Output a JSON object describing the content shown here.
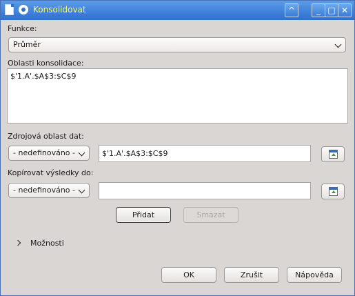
{
  "titlebar": {
    "title": "Konsolidovat",
    "minimize_label": "_",
    "maximize_label": "□",
    "close_label": "✕",
    "shade_label": "^"
  },
  "function": {
    "label": "Funkce:",
    "value": "Průměr"
  },
  "consolidation": {
    "label": "Oblasti konsolidace:",
    "areas": "$'1.A'.$A$3:$C$9"
  },
  "source": {
    "label": "Zdrojová oblast dat:",
    "select_value": "- nedefinováno -",
    "input_value": "$'1.A'.$A$3:$C$9"
  },
  "copy_to": {
    "label": "Kopírovat výsledky do:",
    "select_value": "- nedefinováno -",
    "input_value": ""
  },
  "actions": {
    "add_label": "Přidat",
    "delete_label": "Smazat"
  },
  "options": {
    "label": "Možnosti"
  },
  "footer": {
    "ok_label": "OK",
    "cancel_label": "Zrušit",
    "help_label": "Nápověda"
  }
}
